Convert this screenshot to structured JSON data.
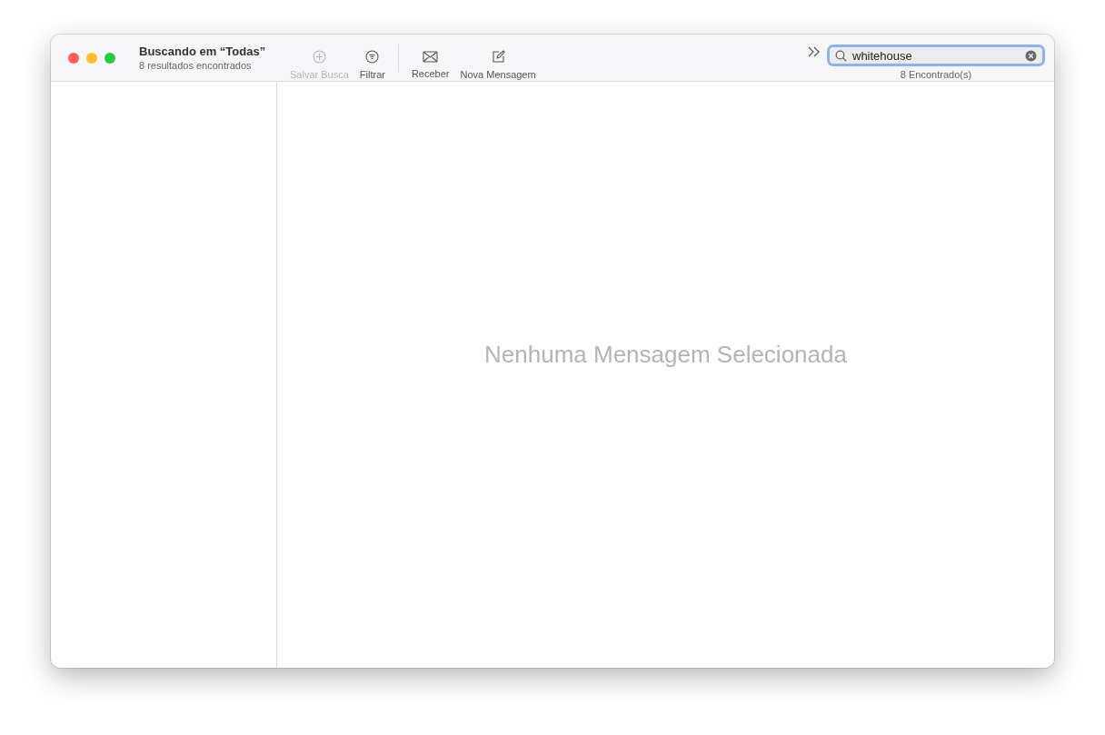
{
  "window": {
    "title": "Buscando em “Todas”",
    "subtitle": "8 resultados encontrados"
  },
  "toolbar_groups": [
    [
      {
        "kind": "plus",
        "label": "Salvar Busca",
        "disabled": true
      },
      {
        "kind": "filter",
        "label": "Filtrar",
        "disabled": false
      }
    ],
    [
      {
        "kind": "envelope",
        "label": "Receber",
        "disabled": false
      },
      {
        "kind": "compose",
        "label": "Nova Mensagem",
        "disabled": false
      }
    ]
  ],
  "search": {
    "value": "whitehouse",
    "result_count": "8 Encontrado(s)"
  },
  "viewer": {
    "empty_message": "Nenhuma Mensagem Selecionada"
  }
}
